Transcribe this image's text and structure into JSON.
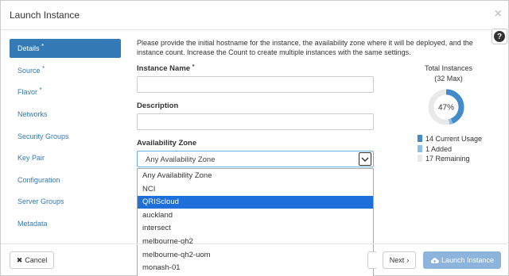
{
  "modal": {
    "title": "Launch Instance",
    "close_symbol": "×",
    "help_symbol": "?"
  },
  "sidebar": {
    "items": [
      {
        "label": "Details",
        "required": "*"
      },
      {
        "label": "Source",
        "required": "*"
      },
      {
        "label": "Flavor",
        "required": "*"
      },
      {
        "label": "Networks",
        "required": ""
      },
      {
        "label": "Security Groups",
        "required": ""
      },
      {
        "label": "Key Pair",
        "required": ""
      },
      {
        "label": "Configuration",
        "required": ""
      },
      {
        "label": "Server Groups",
        "required": ""
      },
      {
        "label": "Metadata",
        "required": ""
      }
    ]
  },
  "details": {
    "intro": "Please provide the initial hostname for the instance, the availability zone where it will be deployed, and the instance count. Increase the Count to create multiple instances with the same settings.",
    "instance_name_label": "Instance Name",
    "required_mark": "*",
    "instance_name_value": "",
    "description_label": "Description",
    "description_value": "",
    "availability_zone_label": "Availability Zone",
    "availability_zone_value": "Any Availability Zone",
    "zone_options": [
      "Any Availability Zone",
      "NCI",
      "QRIScloud",
      "auckland",
      "intersect",
      "melbourne-qh2",
      "melbourne-qh2-uom",
      "monash-01"
    ],
    "highlighted_option": "QRIScloud"
  },
  "quota": {
    "title": "Total Instances",
    "subtitle": "(32 Max)",
    "percent_label": "47%",
    "current_usage": 14,
    "added": 1,
    "remaining": 17,
    "legend": [
      {
        "count": "14",
        "label": "Current Usage"
      },
      {
        "count": "1",
        "label": "Added"
      },
      {
        "count": "17",
        "label": "Remaining"
      }
    ],
    "colors": {
      "current": "#428bca",
      "added": "#8fbfe8",
      "remaining": "#e9e9e9"
    }
  },
  "footer": {
    "cancel_label": "Cancel",
    "next_label": "Next",
    "launch_label": "Launch Instance"
  }
}
